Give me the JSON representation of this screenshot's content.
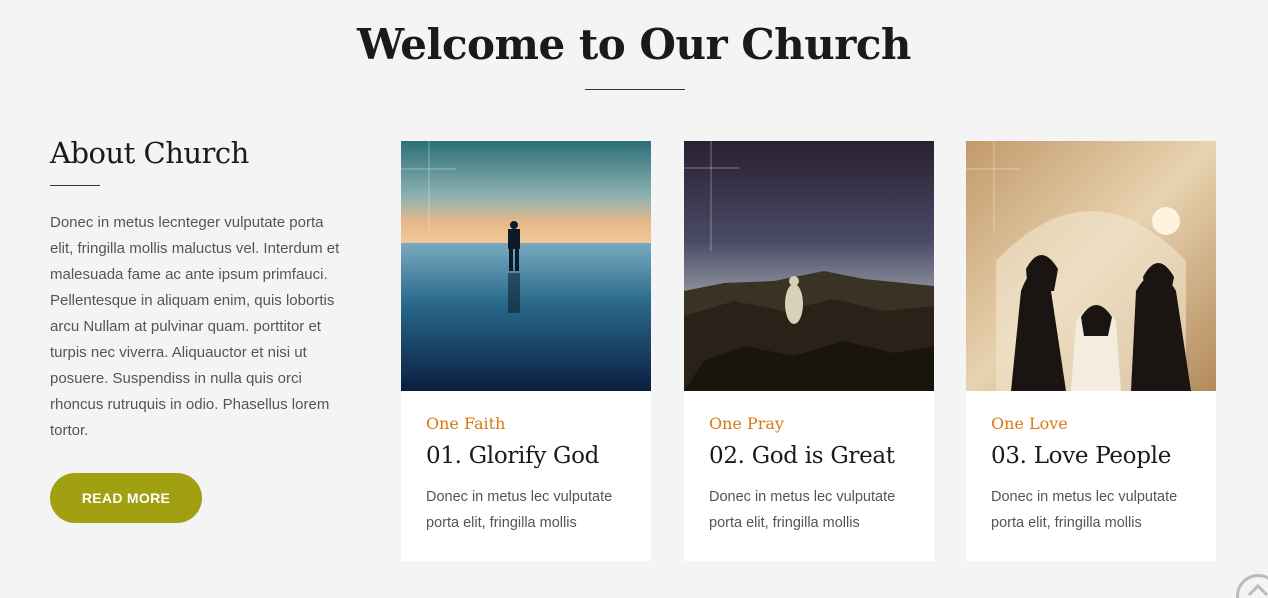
{
  "section": {
    "title": "Welcome to Our Church"
  },
  "about": {
    "heading": "About Church",
    "body": "Donec in metus lecnteger vulputate porta elit, fringilla mollis maluctus vel. Interdum et malesuada fame ac ante ipsum primfauci. Pellentesque in aliquam enim, quis lobortis arcu Nullam at pulvinar quam. porttitor et turpis nec viverra. Aliquauctor et nisi ut posuere. Suspendiss in nulla quis orci rhoncus rutruquis in odio. Phasellus lorem tortor.",
    "button_label": "READ MORE"
  },
  "cards": [
    {
      "kicker": "One Faith",
      "title": "01. Glorify God",
      "description": "Donec in metus lec vulputate porta elit, fringilla mollis",
      "image": "person-on-beach-at-dusk"
    },
    {
      "kicker": "One Pray",
      "title": "02. God is Great",
      "description": "Donec in metus lec vulputate porta elit, fringilla mollis",
      "image": "robed-figure-on-rocks"
    },
    {
      "kicker": "One Love",
      "title": "03. Love People",
      "description": "Donec in metus lec vulputate porta elit, fringilla mollis",
      "image": "nuns-in-church"
    }
  ],
  "colors": {
    "accent": "#a0a010",
    "kicker": "#d97a14",
    "background": "#f4f4f4"
  },
  "icons": {
    "scroll_top": "chevron-up-icon"
  }
}
